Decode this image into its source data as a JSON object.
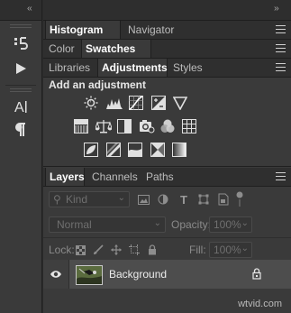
{
  "toolbar": {
    "collapse_left": "‹‹",
    "tools": [
      "history-brush-icon",
      "play-icon",
      "character-icon",
      "paragraph-icon"
    ]
  },
  "panels": {
    "collapse_right": "››",
    "group1": {
      "tabs": [
        "Histogram",
        "Navigator"
      ],
      "active": "Histogram"
    },
    "group2": {
      "tabs": [
        "Color",
        "Swatches"
      ],
      "active": "Swatches"
    },
    "group3": {
      "tabs": [
        "Libraries",
        "Adjustments",
        "Styles"
      ],
      "active": "Adjustments"
    },
    "adjustments": {
      "title": "Add an adjustment",
      "row1": [
        "brightness-icon",
        "levels-icon",
        "curves-icon",
        "exposure-icon",
        "vibrance-icon"
      ],
      "row2": [
        "hue-sat-icon",
        "color-balance-icon",
        "bw-icon",
        "photo-filter-icon",
        "channel-mixer-icon",
        "color-lookup-icon"
      ],
      "row3": [
        "invert-icon",
        "posterize-icon",
        "threshold-icon",
        "selective-color-icon",
        "gradient-map-icon"
      ]
    },
    "group4": {
      "tabs": [
        "Layers",
        "Channels",
        "Paths"
      ],
      "active": "Layers"
    }
  },
  "layers": {
    "filter_placeholder": "Kind",
    "blend_mode": "Normal",
    "opacity_label": "Opacity:",
    "opacity_value": "100%",
    "lock_label": "Lock:",
    "fill_label": "Fill:",
    "fill_value": "100%",
    "layer_name": "Background"
  },
  "watermark": "wtvid.com"
}
